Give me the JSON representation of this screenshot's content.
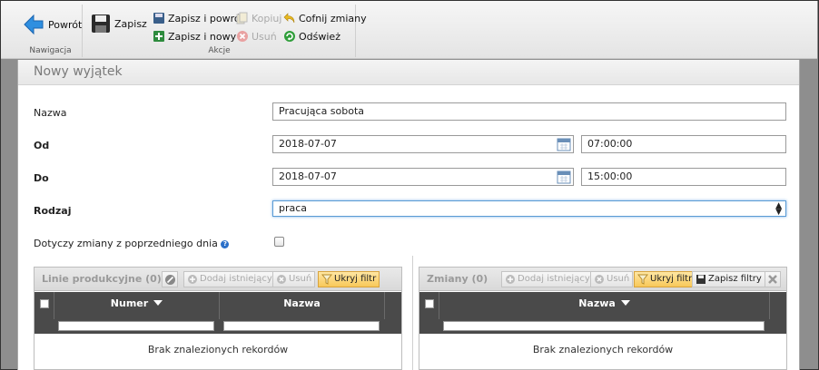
{
  "ribbon": {
    "nav_group": "Nawigacja",
    "actions_group": "Akcje",
    "back": "Powrót",
    "save": "Zapisz",
    "save_and_back": "Zapisz i powrót",
    "save_and_new": "Zapisz i nowy",
    "copy": "Kopiuj",
    "delete": "Usuń",
    "undo": "Cofnij zmiany",
    "refresh": "Odśwież"
  },
  "form": {
    "title": "Nowy wyjątek",
    "name_label": "Nazwa",
    "name_value": "Pracująca sobota",
    "from_label": "Od",
    "from_date": "2018-07-07",
    "from_time": "07:00:00",
    "to_label": "Do",
    "to_date": "2018-07-07",
    "to_time": "15:00:00",
    "type_label": "Rodzaj",
    "type_value": "praca",
    "prev_day_label": "Dotyczy zmiany z poprzedniego dnia",
    "prev_day_help": "?"
  },
  "lines_table": {
    "title": "Linie produkcyjne (0)",
    "add_existing": "Dodaj istniejący",
    "delete": "Usuń",
    "hide_filter": "Ukryj filtr",
    "col_number": "Numer",
    "col_name": "Nazwa",
    "empty": "Brak znalezionych rekordów"
  },
  "shifts_table": {
    "title": "Zmiany (0)",
    "add_existing": "Dodaj istniejący",
    "delete": "Usuń",
    "hide_filter": "Ukryj filtr",
    "save_filters": "Zapisz filtry",
    "col_name": "Nazwa",
    "empty": "Brak znalezionych rekordów"
  }
}
